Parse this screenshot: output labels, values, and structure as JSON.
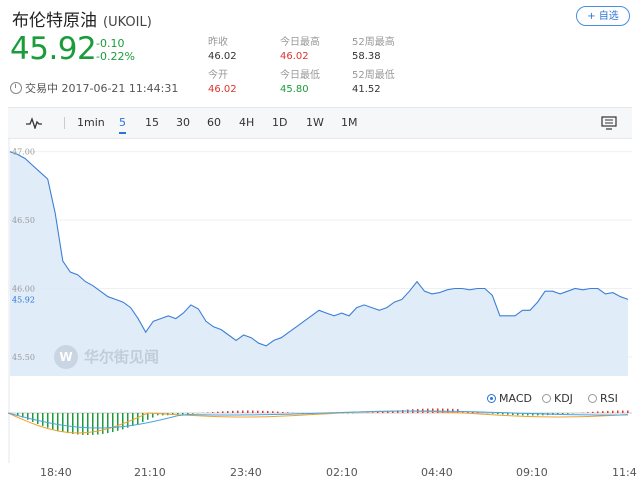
{
  "header": {
    "name": "布伦特原油",
    "symbol": "(UKOIL)",
    "add_label": "+ 自选",
    "price": "45.92",
    "change": "-0.10",
    "change_pct": "-0.22%",
    "status": "交易中 2017-06-21 11:44:31"
  },
  "stats": [
    {
      "label": "昨收",
      "value": "46.02",
      "color": "#333333"
    },
    {
      "label": "今日最高",
      "value": "46.02",
      "color": "#e0332e"
    },
    {
      "label": "52周最高",
      "value": "58.38",
      "color": "#333333"
    },
    {
      "label": "今开",
      "value": "46.02",
      "color": "#e0332e"
    },
    {
      "label": "今日最低",
      "value": "45.80",
      "color": "#1a9c3a"
    },
    {
      "label": "52周最低",
      "value": "41.52",
      "color": "#333333"
    }
  ],
  "toolbar": {
    "intervals": [
      "1min",
      "5",
      "15",
      "30",
      "60",
      "4H",
      "1D",
      "1W",
      "1M"
    ],
    "active": "5"
  },
  "indicators": {
    "items": [
      "MACD",
      "KDJ",
      "RSI"
    ],
    "selected": "MACD"
  },
  "watermark": "华尔街见闻",
  "colors": {
    "up": "#e0332e",
    "down": "#1a9c3a",
    "line": "#3d7fd6",
    "accent": "#2a74d6"
  },
  "chart_data": {
    "type": "area",
    "y_ticks": [
      "47.00",
      "46.50",
      "46.00",
      "45.50"
    ],
    "ylim": [
      45.36,
      47.1
    ],
    "current_label": "45.92",
    "x_ticks": [
      "18:40",
      "21:10",
      "23:40",
      "02:10",
      "04:40",
      "09:10",
      "11:4"
    ],
    "values": [
      47.0,
      46.98,
      46.95,
      46.9,
      46.85,
      46.8,
      46.55,
      46.2,
      46.12,
      46.1,
      46.05,
      46.02,
      45.98,
      45.94,
      45.92,
      45.9,
      45.86,
      45.78,
      45.68,
      45.76,
      45.78,
      45.8,
      45.78,
      45.82,
      45.88,
      45.85,
      45.76,
      45.72,
      45.7,
      45.66,
      45.62,
      45.66,
      45.64,
      45.6,
      45.58,
      45.62,
      45.64,
      45.68,
      45.72,
      45.76,
      45.8,
      45.84,
      45.82,
      45.8,
      45.82,
      45.8,
      45.86,
      45.88,
      45.86,
      45.84,
      45.86,
      45.9,
      45.92,
      45.98,
      46.05,
      45.98,
      45.96,
      45.97,
      45.99,
      46.0,
      46.0,
      45.99,
      46.0,
      46.0,
      45.95,
      45.8,
      45.8,
      45.8,
      45.84,
      45.84,
      45.9,
      45.98,
      45.98,
      45.96,
      45.98,
      46.0,
      45.99,
      46.0,
      46.0,
      45.96,
      45.97,
      45.94,
      45.92
    ]
  }
}
